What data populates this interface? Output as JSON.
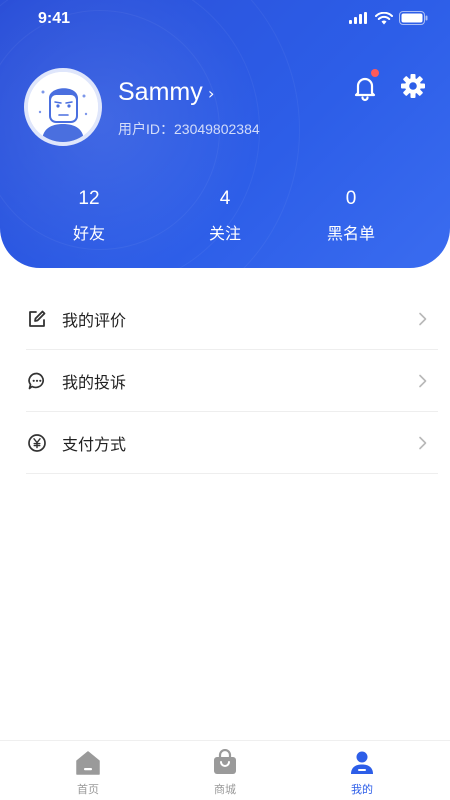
{
  "status_bar": {
    "time": "9:41"
  },
  "profile": {
    "name": "Sammy",
    "user_id": "用户ID：23049802384",
    "has_notification": true
  },
  "stats": [
    {
      "value": "12",
      "label": "好友"
    },
    {
      "value": "4",
      "label": "关注"
    },
    {
      "value": "0",
      "label": "黑名单"
    }
  ],
  "menu": [
    {
      "label": "我的评价",
      "icon": "edit-icon"
    },
    {
      "label": "我的投诉",
      "icon": "chat-icon"
    },
    {
      "label": "支付方式",
      "icon": "yuan-icon"
    }
  ],
  "tabs": [
    {
      "label": "首页",
      "icon": "home-icon",
      "active": false
    },
    {
      "label": "商城",
      "icon": "shop-bag-icon",
      "active": false
    },
    {
      "label": "我的",
      "icon": "user-icon",
      "active": true
    }
  ],
  "colors": {
    "primary": "#2d5ee8",
    "inactive": "#9a9a9a",
    "badge": "#ff5a5a"
  }
}
